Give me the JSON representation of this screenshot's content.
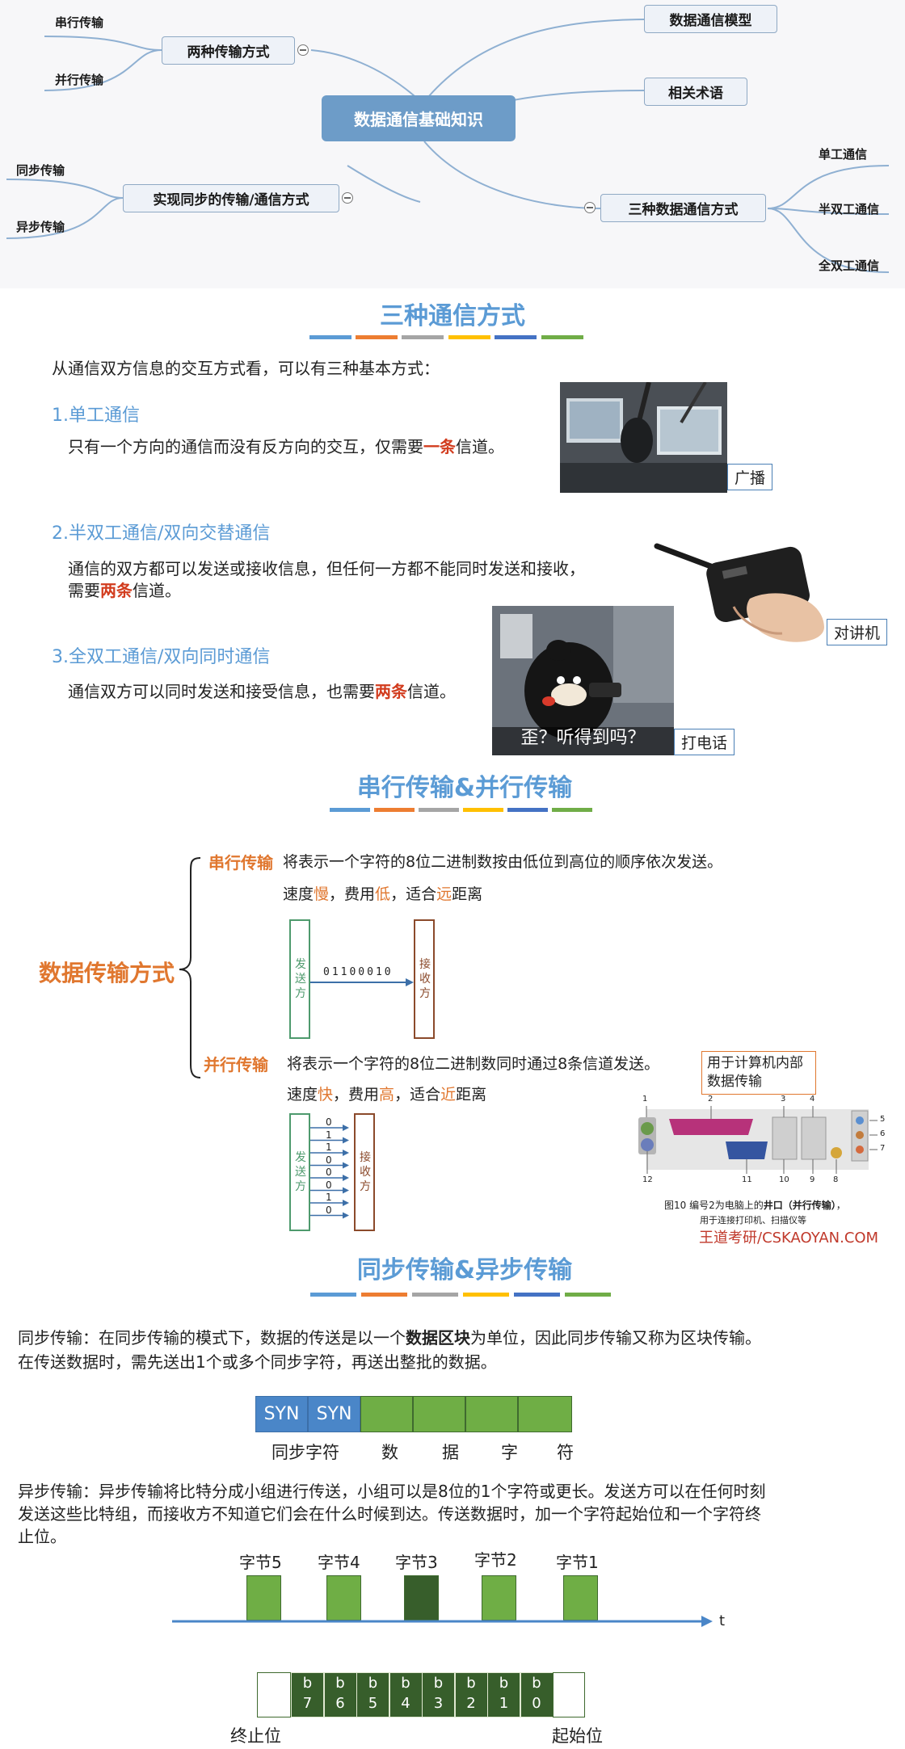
{
  "mindmap": {
    "root": "数据通信基础知识",
    "left_branches": [
      {
        "label": "两种传输方式",
        "children": [
          "串行传输",
          "并行传输"
        ]
      },
      {
        "label": "实现同步的传输/通信方式",
        "children": [
          "同步传输",
          "异步传输"
        ]
      }
    ],
    "right_branches": [
      {
        "label": "数据通信模型"
      },
      {
        "label": "相关术语"
      },
      {
        "label": "三种数据通信方式",
        "children": [
          "单工通信",
          "半双工通信",
          "全双工通信"
        ]
      }
    ]
  },
  "section1": {
    "title": "三种通信方式",
    "intro": "从通信双方信息的交互方式看，可以有三种基本方式：",
    "items": [
      {
        "heading": "1.单工通信",
        "text_before": "只有一个方向的通信而没有反方向的交互，仅需要",
        "highlight": "一条",
        "text_after": "信道。",
        "caption": "广播"
      },
      {
        "heading": "2.半双工通信/双向交替通信",
        "line1": "通信的双方都可以发送或接收信息，但任何一方都不能同时发送和接收，",
        "line2_before": "需要",
        "highlight": "两条",
        "line2_after": "信道。",
        "caption": "对讲机"
      },
      {
        "heading": "3.全双工通信/双向同时通信",
        "text_before": "通信双方可以同时发送和接受信息，也需要",
        "highlight": "两条",
        "text_after": "信道。",
        "caption": "打电话",
        "photo_subtitle": "歪？听得到吗？"
      }
    ]
  },
  "section2": {
    "title": "串行传输&并行传输",
    "main_label": "数据传输方式",
    "serial": {
      "label": "串行传输",
      "desc": "将表示一个字符的8位二进制数按由低位到高位的顺序依次发送。",
      "speed_pre": "速度",
      "speed": "慢",
      "cost_pre": "，费用",
      "cost": "低",
      "dist_pre": "，适合",
      "dist": "远",
      "dist_post": "距离",
      "sender": "发送方",
      "receiver": "接收方",
      "bits": "01100010"
    },
    "parallel": {
      "label": "并行传输",
      "desc": "将表示一个字符的8位二进制数同时通过8条信道发送。",
      "speed_pre": "速度",
      "speed": "快",
      "cost_pre": "，费用",
      "cost": "高",
      "dist_pre": "，适合",
      "dist": "近",
      "dist_post": "距离",
      "sender": "发送方",
      "receiver": "接收方",
      "bits": [
        "0",
        "1",
        "1",
        "0",
        "0",
        "0",
        "1",
        "0"
      ],
      "note": "用于计算机内部数据传输"
    },
    "port_figure": {
      "caption_pre": "图10  编号2为电脑上的",
      "caption_bold": "井口（并行传输）",
      "caption_post": "，",
      "caption_line2": "用于连接打印机、扫描仪等",
      "watermark": "王道考研/CSKAOYAN.COM",
      "numbers": [
        "1",
        "2",
        "3",
        "4",
        "5",
        "6",
        "7",
        "8",
        "9",
        "10",
        "11",
        "12"
      ]
    }
  },
  "section3": {
    "title": "同步传输&异步传输",
    "sync_line1_pre": "同步传输：在同步传输的模式下，数据的传送是以一个",
    "sync_line1_bold": "数据区块",
    "sync_line1_post": "为单位，因此同步传输又称为区块传输。",
    "sync_line2": "在传送数据时，需先送出1个或多个同步字符，再送出整批的数据。",
    "syn_blocks": [
      "SYN",
      "SYN"
    ],
    "sync_labels": [
      "同步字符",
      "数",
      "据",
      "字",
      "符"
    ],
    "async_line1": "异步传输：异步传输将比特分成小组进行传送，小组可以是8位的1个字符或更长。发送方可以在任何时刻",
    "async_line2": "发送这些比特组，而接收方不知道它们会在什么时候到达。传送数据时，加一个字符起始位和一个字符终",
    "async_line3": "止位。",
    "bytes": [
      "字节5",
      "字节4",
      "字节3",
      "字节2",
      "字节1"
    ],
    "axis_label": "t",
    "bits_top": [
      "b",
      "b",
      "b",
      "b",
      "b",
      "b",
      "b",
      "b"
    ],
    "bits_bottom": [
      "7",
      "6",
      "5",
      "4",
      "3",
      "2",
      "1",
      "0"
    ],
    "stop_label": "终止位",
    "start_label": "起始位"
  },
  "colors": {
    "accent_blue": "#5b9bd5",
    "highlight_red": "#d23c1e",
    "orange": "#e0772f",
    "syn_blue": "#4a86c8",
    "data_green": "#6fae45",
    "dark_green": "#375e2b",
    "title_bar": [
      "#5b9bd5",
      "#ed7d31",
      "#a5a5a5",
      "#ffc000",
      "#4472c4",
      "#70ad47"
    ]
  }
}
